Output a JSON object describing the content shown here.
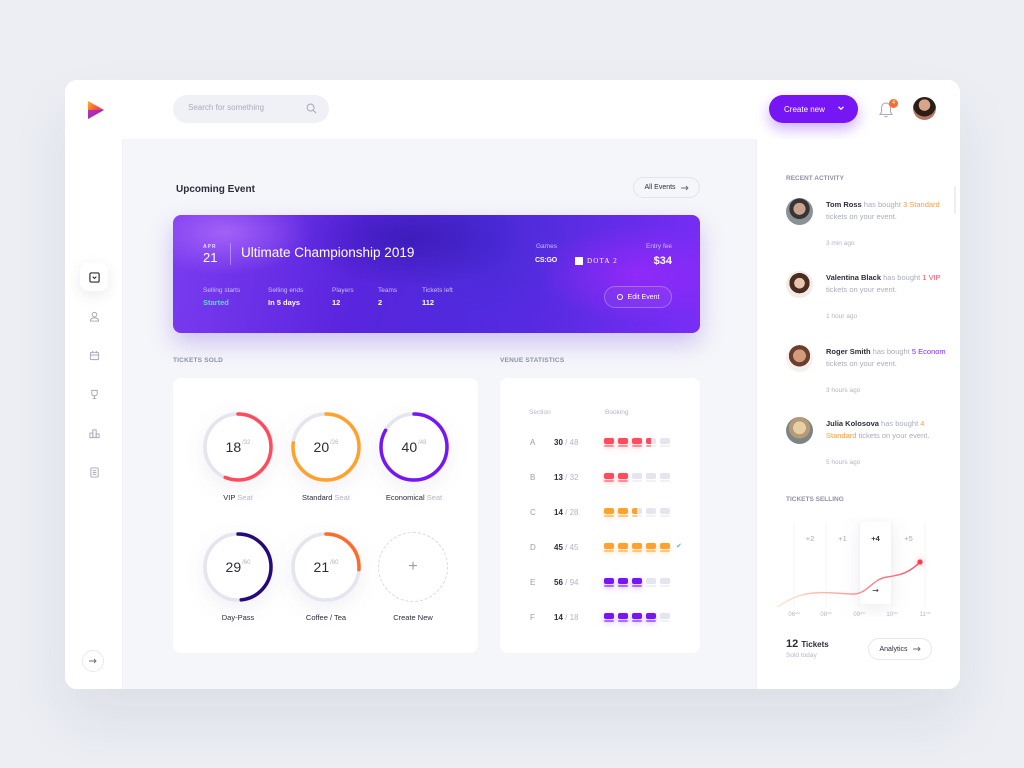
{
  "header": {
    "search_placeholder": "Search for something",
    "create_label": "Create new",
    "notification_count": "4",
    "accent_color": "#7716f5"
  },
  "sidebar": {
    "items": [
      {
        "name": "dashboard",
        "icon": "inbox-icon",
        "active": true
      },
      {
        "name": "users",
        "icon": "user-icon",
        "active": false
      },
      {
        "name": "events",
        "icon": "calendar-icon",
        "active": false
      },
      {
        "name": "trophies",
        "icon": "trophy-icon",
        "active": false
      },
      {
        "name": "stats",
        "icon": "podium-icon",
        "active": false
      },
      {
        "name": "reports",
        "icon": "document-icon",
        "active": false
      }
    ],
    "expand_icon": "arrow-right-icon"
  },
  "upcoming": {
    "title": "Upcoming Event",
    "all_events_label": "All Events",
    "event": {
      "month": "APR",
      "day": "21",
      "name": "Ultimate Championship 2019",
      "stats": [
        {
          "label": "Selling starts",
          "value": "Started"
        },
        {
          "label": "Selling ends",
          "value": "In 5 days"
        },
        {
          "label": "Players",
          "value": "12"
        },
        {
          "label": "Teams",
          "value": "2"
        },
        {
          "label": "Tickets left",
          "value": "112"
        }
      ],
      "games_label": "Games",
      "games": [
        "CS:GO",
        "DOTA 2"
      ],
      "fee_label": "Entry fee",
      "fee": "$34",
      "edit_label": "Edit Event"
    }
  },
  "tickets_sold": {
    "title": "TICKETS SOLD",
    "items": [
      {
        "label": "VIP",
        "suffix": "Seat",
        "sold": 18,
        "total": 32,
        "color": "#ff4b5c"
      },
      {
        "label": "Standard",
        "suffix": "Seat",
        "sold": 20,
        "total": 26,
        "color": "#ffa22d"
      },
      {
        "label": "Economical",
        "suffix": "Seat",
        "sold": 40,
        "total": 48,
        "color": "#7716f5"
      },
      {
        "label": "Day-Pass",
        "suffix": "",
        "sold": 29,
        "total": 60,
        "color": "#250a7a"
      },
      {
        "label": "Coffee / Tea",
        "suffix": "",
        "sold": 21,
        "total": 80,
        "color": "#ff6b2c"
      }
    ],
    "create_label": "Create New"
  },
  "venue": {
    "title": "VENUE STATISTICS",
    "col_section": "Section",
    "col_booking": "Booking",
    "rows": [
      {
        "section": "A",
        "booked": 30,
        "total": 48,
        "color": "#ff4b5c",
        "fill": 3.5,
        "full": false
      },
      {
        "section": "B",
        "booked": 13,
        "total": 32,
        "color": "#ff4b5c",
        "fill": 2,
        "full": false
      },
      {
        "section": "C",
        "booked": 14,
        "total": 28,
        "color": "#ffa22d",
        "fill": 2.5,
        "full": false
      },
      {
        "section": "D",
        "booked": 45,
        "total": 45,
        "color": "#ffa22d",
        "fill": 5,
        "full": true
      },
      {
        "section": "E",
        "booked": 56,
        "total": 94,
        "color": "#7716f5",
        "fill": 3,
        "full": false
      },
      {
        "section": "F",
        "booked": 14,
        "total": 18,
        "color": "#7716f5",
        "fill": 4,
        "full": false
      }
    ]
  },
  "activity": {
    "title": "RECENT ACTIVITY",
    "items": [
      {
        "name": "Tom Ross",
        "pre": "has bought",
        "highlight": "3 Standard",
        "hl_class": "hl-orange",
        "post": "tickets on your event.",
        "time": "3 min ago"
      },
      {
        "name": "Valentina Black",
        "pre": "has bought",
        "highlight": "1 VIP",
        "hl_class": "hl-red",
        "post": "tickets on your event.",
        "time": "1 hour ago"
      },
      {
        "name": "Roger Smith",
        "pre": "has bought",
        "highlight": "5 Econom",
        "hl_class": "hl-purple",
        "post": "tickets on your event.",
        "time": "3 hours ago"
      },
      {
        "name": "Julia Kolosova",
        "pre": "has bought",
        "highlight": "4 Standard",
        "hl_class": "hl-orange",
        "post": "tickets on your event.",
        "time": "5 hours ago"
      }
    ]
  },
  "tickets_selling": {
    "title": "TICKETS SELLING",
    "sold_count": "12",
    "sold_unit": "Tickets",
    "sold_sub": "Sold today",
    "analytics_label": "Analytics",
    "chart_data": {
      "type": "line",
      "x": [
        "06 AM",
        "08 AM",
        "09 AM",
        "10 AM",
        "11 AM"
      ],
      "increments": [
        "+2",
        "+1",
        "+4",
        "+5"
      ],
      "highlighted_index": 2,
      "series": [
        {
          "name": "Tickets",
          "values": [
            0,
            2,
            3,
            7,
            12
          ]
        }
      ]
    }
  }
}
